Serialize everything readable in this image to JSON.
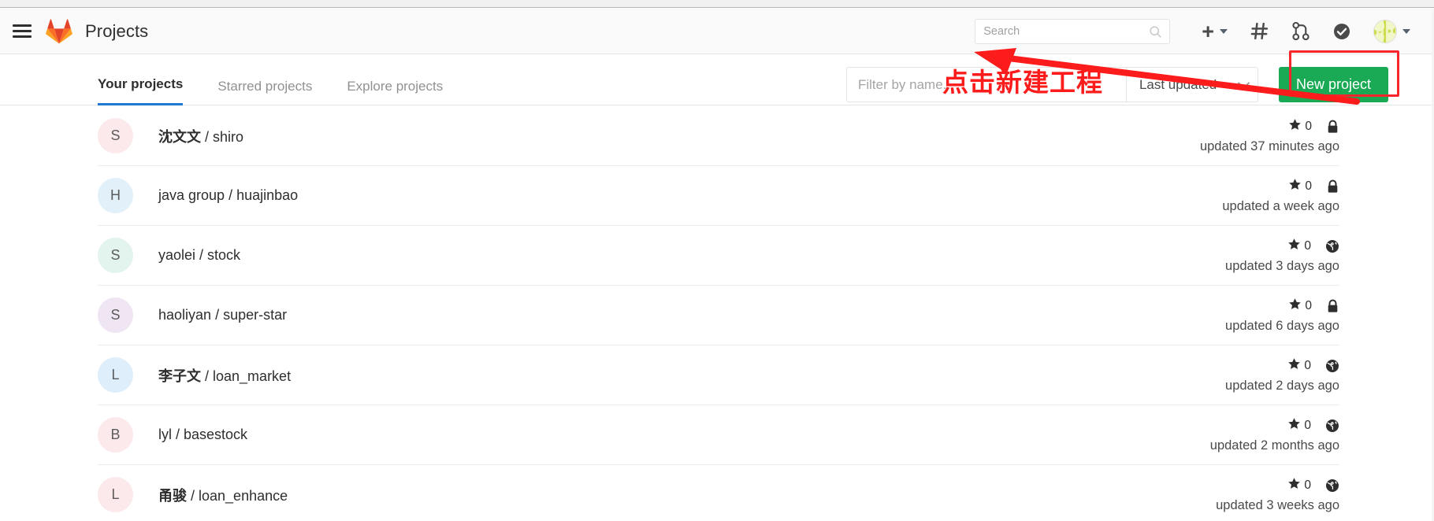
{
  "navbar": {
    "hamburger_icon": "hamburger-menu-icon",
    "logo_icon": "gitlab-logo-icon",
    "title": "Projects",
    "search": {
      "placeholder": "Search",
      "value": "",
      "icon": "search-icon"
    },
    "icons": [
      {
        "name": "plus-icon",
        "glyph": "+",
        "has_caret": true
      },
      {
        "name": "issues-hash-icon",
        "glyph": "#",
        "has_caret": false
      },
      {
        "name": "merge-request-icon",
        "glyph": "merge",
        "has_caret": false
      },
      {
        "name": "todos-check-icon",
        "glyph": "check",
        "has_caret": false
      },
      {
        "name": "user-avatar",
        "glyph": "avatar",
        "has_caret": true
      }
    ]
  },
  "tabs": [
    {
      "label": "Your projects",
      "active": true
    },
    {
      "label": "Starred projects",
      "active": false
    },
    {
      "label": "Explore projects",
      "active": false
    }
  ],
  "controls": {
    "filter_placeholder": "Filter by name...",
    "filter_value": "",
    "sort_label": "Last updated",
    "sort_caret_icon": "chevron-down-icon",
    "new_project_label": "New project"
  },
  "annotation": {
    "text": "点击新建工程",
    "color": "#fc1c1c",
    "highlight_color": "#f8262c",
    "arrow": "red-arrow-pointing-left"
  },
  "colors": {
    "accent_green": "#1aaa55",
    "tab_active_underline": "#1f78d1",
    "annotation_red": "#fc1c1c"
  },
  "projects": [
    {
      "initial": "S",
      "avatar_color": "#fce9ec",
      "namespace": "沈文文",
      "namespace_bold": true,
      "path": "shiro",
      "stars": "0",
      "visibility": "private",
      "visibility_icon": "lock-icon",
      "updated": "updated 37 minutes ago"
    },
    {
      "initial": "H",
      "avatar_color": "#e1f0f9",
      "namespace": "java group",
      "namespace_bold": false,
      "path": "huajinbao",
      "stars": "0",
      "visibility": "private",
      "visibility_icon": "lock-icon",
      "updated": "updated a week ago"
    },
    {
      "initial": "S",
      "avatar_color": "#e3f3ee",
      "namespace": "yaolei",
      "namespace_bold": false,
      "path": "stock",
      "stars": "0",
      "visibility": "public",
      "visibility_icon": "globe-icon",
      "updated": "updated 3 days ago"
    },
    {
      "initial": "S",
      "avatar_color": "#f0e5f2",
      "namespace": "haoliyan",
      "namespace_bold": false,
      "path": "super-star",
      "stars": "0",
      "visibility": "private",
      "visibility_icon": "lock-icon",
      "updated": "updated 6 days ago"
    },
    {
      "initial": "L",
      "avatar_color": "#deeefb",
      "namespace": "李子文",
      "namespace_bold": true,
      "path": "loan_market",
      "stars": "0",
      "visibility": "public",
      "visibility_icon": "globe-icon",
      "updated": "updated 2 days ago"
    },
    {
      "initial": "B",
      "avatar_color": "#fce9ec",
      "namespace": "lyl",
      "namespace_bold": false,
      "path": "basestock",
      "stars": "0",
      "visibility": "public",
      "visibility_icon": "globe-icon",
      "updated": "updated 2 months ago"
    },
    {
      "initial": "L",
      "avatar_color": "#fce9ec",
      "namespace": "甬骏",
      "namespace_bold": true,
      "path": "loan_enhance",
      "stars": "0",
      "visibility": "public",
      "visibility_icon": "globe-icon",
      "updated": "updated 3 weeks ago"
    }
  ]
}
